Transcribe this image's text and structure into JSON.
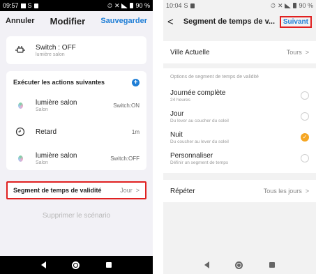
{
  "left": {
    "status": {
      "time": "09:57",
      "battery": "90 %"
    },
    "header": {
      "cancel": "Annuler",
      "title": "Modifier",
      "save": "Sauvegarder"
    },
    "trigger": {
      "name": "Switch : OFF",
      "room": "lumière salon"
    },
    "actions": {
      "title": "Exécuter les actions suivantes",
      "items": [
        {
          "name": "lumière salon",
          "room": "Salon",
          "value": "Switch:ON",
          "icon": "bulb-icon"
        },
        {
          "name": "Retard",
          "room": "",
          "value": "1m",
          "icon": "timer-icon"
        },
        {
          "name": "lumière salon",
          "room": "Salon",
          "value": "Switch:OFF",
          "icon": "bulb-icon"
        }
      ]
    },
    "validity": {
      "label": "Segment de temps de validité",
      "value": "Jour",
      "chevron": ">"
    },
    "delete": "Supprimer le scénario"
  },
  "right": {
    "status": {
      "time": "10:04",
      "battery": "90 %"
    },
    "header": {
      "back": "<",
      "title": "Segment de temps de v...",
      "next": "Suivant"
    },
    "city": {
      "label": "Ville Actuelle",
      "value": "Tours",
      "chevron": ">"
    },
    "options": {
      "heading": "Options de segment de temps de validité",
      "items": [
        {
          "name": "Journée complète",
          "desc": "24 heures",
          "selected": false
        },
        {
          "name": "Jour",
          "desc": "Du lever au coucher du soleil",
          "selected": false
        },
        {
          "name": "Nuit",
          "desc": "Du coucher au lever du soleil",
          "selected": true
        },
        {
          "name": "Personnaliser",
          "desc": "Définir un segment de temps",
          "selected": false
        }
      ]
    },
    "repeat": {
      "label": "Répéter",
      "value": "Tous les jours",
      "chevron": ">"
    }
  },
  "colors": {
    "accent": "#1f7ed6",
    "highlight": "#e02020",
    "selected": "#f5a623",
    "dark_bar": "#000000"
  }
}
